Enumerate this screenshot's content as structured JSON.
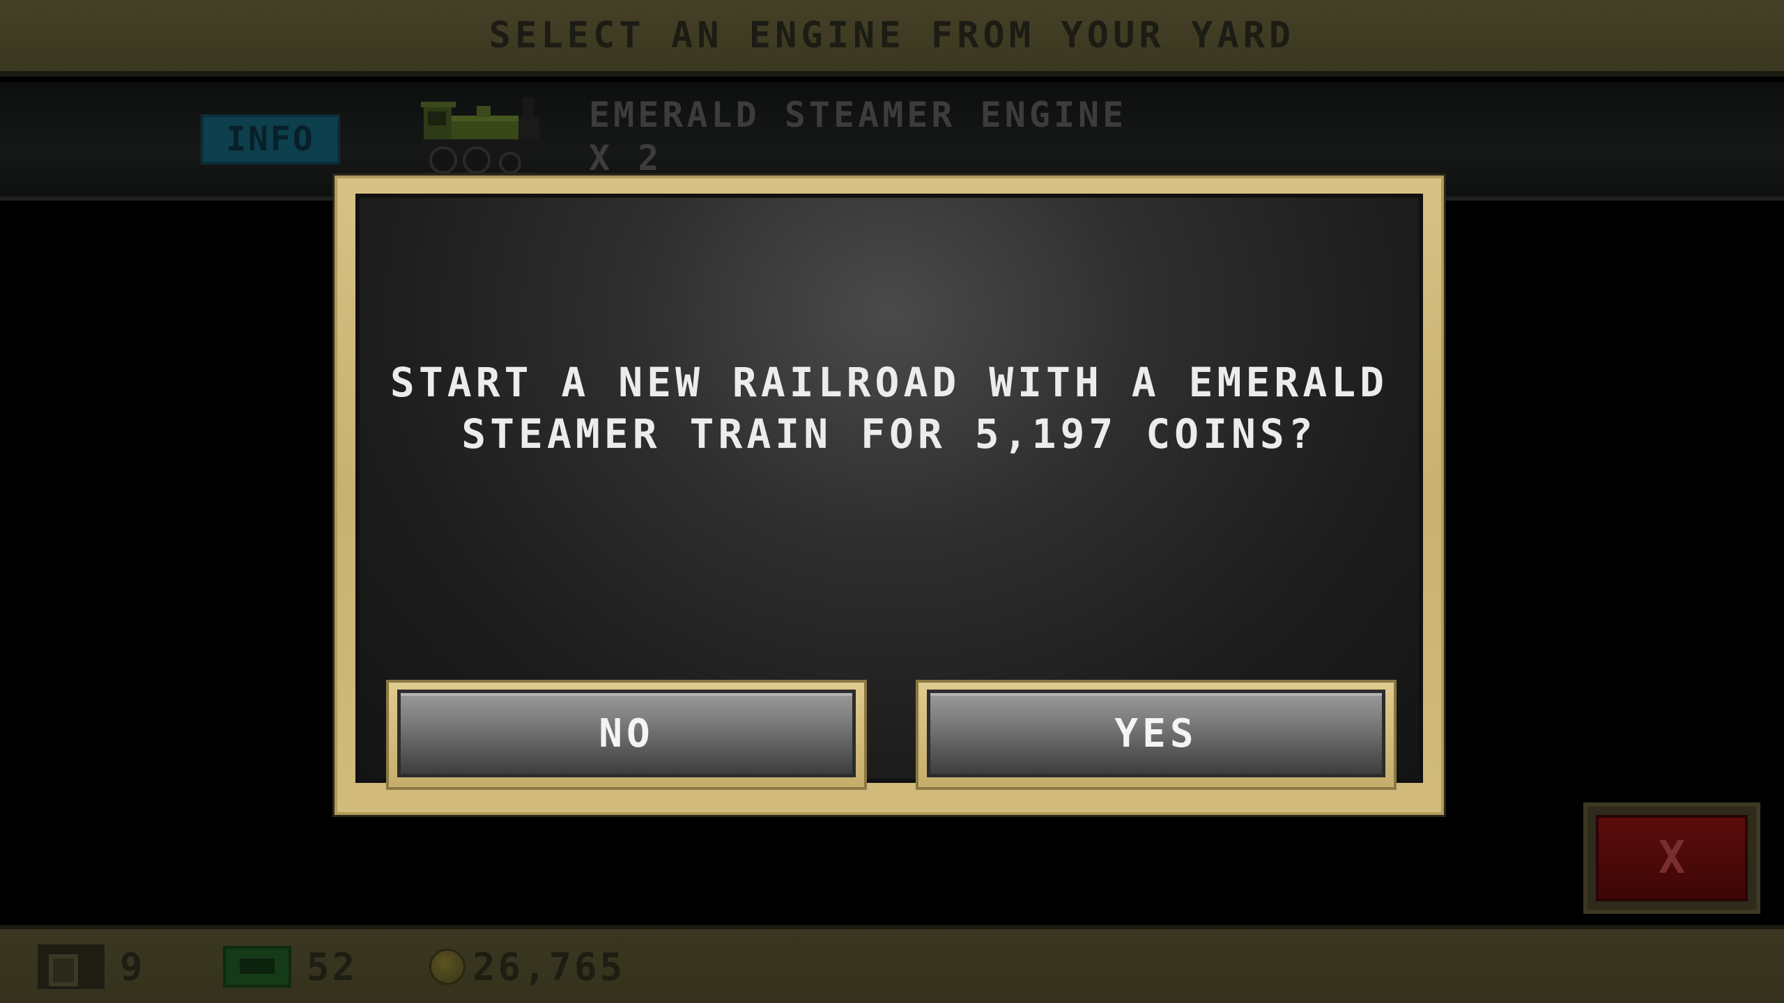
{
  "header": {
    "title": "SELECT AN ENGINE FROM YOUR YARD"
  },
  "engine_row": {
    "info_label": "INFO",
    "engine_icon": "green-steam-locomotive-icon",
    "engine_name": "EMERALD STEAMER ENGINE",
    "engine_count": "X 2"
  },
  "dialog": {
    "message_line1": "START A NEW RAILROAD WITH A EMERALD",
    "message_line2": "STEAMER TRAIN FOR 5,197 COINS?",
    "no_label": "NO",
    "yes_label": "YES"
  },
  "close_button": {
    "icon": "close-x-icon",
    "label": "X"
  },
  "bottom_bar": {
    "stations": "9",
    "cash": "52",
    "coins": "26,765"
  },
  "colors": {
    "modal_border": "#d2bb7c",
    "modal_background": "#1c1c1c",
    "info_button": "#0d3f4d",
    "close_button": "#5c0d0d",
    "header_bar": "#454127"
  }
}
